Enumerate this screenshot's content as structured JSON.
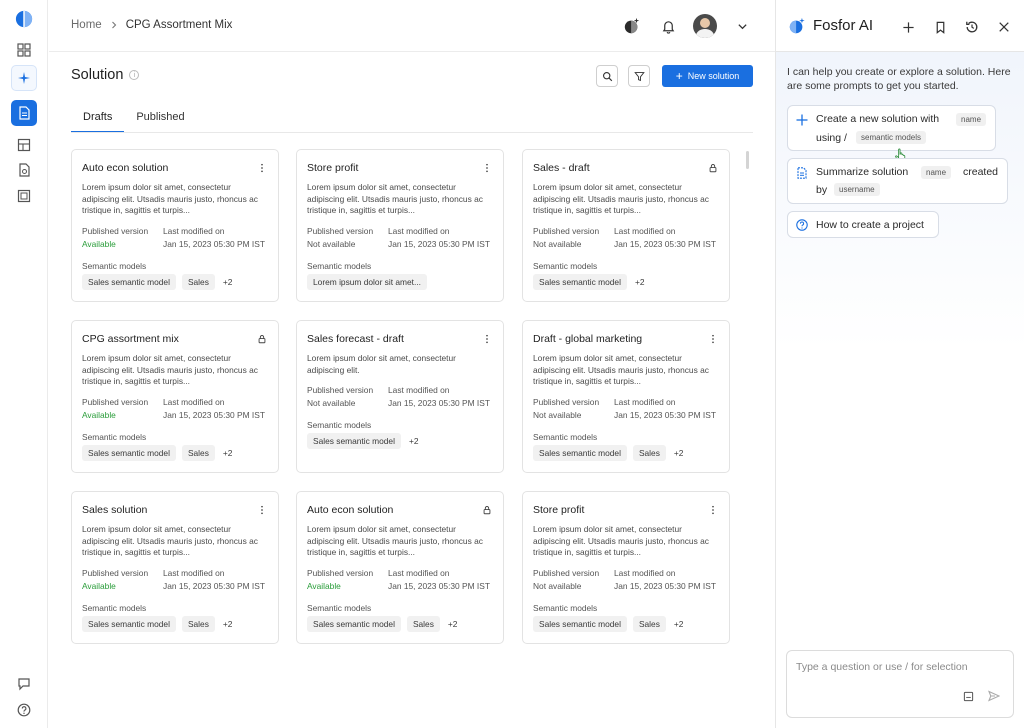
{
  "breadcrumb": {
    "home": "Home",
    "current": "CPG Assortment Mix"
  },
  "page": {
    "title": "Solution",
    "new_button": "New solution"
  },
  "tabs": [
    "Drafts",
    "Published"
  ],
  "cards": [
    {
      "title": "Auto econ solution",
      "locked": false,
      "description": "Lorem ipsum dolor sit amet, consectetur adipiscing elit. Utsadis mauris justo, rhoncus ac tristique in, sagittis et turpis...",
      "published_label": "Published version",
      "published_value": "Available",
      "published_available": true,
      "modified_label": "Last modified on",
      "modified_value": "Jan 15, 2023 05:30 PM IST",
      "models_label": "Semantic models",
      "chips": [
        "Sales semantic model",
        "Sales"
      ],
      "more": "+2"
    },
    {
      "title": "Store profit",
      "locked": false,
      "description": "Lorem ipsum dolor sit amet, consectetur adipiscing elit. Utsadis mauris justo, rhoncus ac tristique in, sagittis et turpis...",
      "published_label": "Published version",
      "published_value": "Not available",
      "published_available": false,
      "modified_label": "Last modified on",
      "modified_value": "Jan 15, 2023 05:30 PM IST",
      "models_label": "Semantic models",
      "chips": [
        "Lorem ipsum dolor sit amet..."
      ],
      "more": ""
    },
    {
      "title": "Sales - draft",
      "locked": true,
      "description": "Lorem ipsum dolor sit amet, consectetur adipiscing elit. Utsadis mauris justo, rhoncus ac tristique in, sagittis et turpis...",
      "published_label": "Published version",
      "published_value": "Not available",
      "published_available": false,
      "modified_label": "Last modified on",
      "modified_value": "Jan 15, 2023 05:30 PM IST",
      "models_label": "Semantic models",
      "chips": [
        "Sales semantic model"
      ],
      "more": "+2"
    },
    {
      "title": "CPG assortment mix",
      "locked": true,
      "description": "Lorem ipsum dolor sit amet, consectetur adipiscing elit. Utsadis mauris justo, rhoncus ac tristique in, sagittis et turpis...",
      "published_label": "Published version",
      "published_value": "Available",
      "published_available": true,
      "modified_label": "Last modified on",
      "modified_value": "Jan 15, 2023 05:30 PM IST",
      "models_label": "Semantic models",
      "chips": [
        "Sales semantic model",
        "Sales"
      ],
      "more": "+2"
    },
    {
      "title": "Sales forecast - draft",
      "locked": false,
      "description": "Lorem ipsum dolor sit amet, consectetur adipiscing elit.",
      "published_label": "Published version",
      "published_value": "Not available",
      "published_available": false,
      "modified_label": "Last modified on",
      "modified_value": "Jan 15, 2023 05:30 PM IST",
      "models_label": "Semantic models",
      "chips": [
        "Sales semantic model"
      ],
      "more": "+2"
    },
    {
      "title": "Draft - global marketing",
      "locked": false,
      "description": "Lorem ipsum dolor sit amet, consectetur adipiscing elit. Utsadis mauris justo, rhoncus ac tristique in, sagittis et turpis...",
      "published_label": "Published version",
      "published_value": "Not available",
      "published_available": false,
      "modified_label": "Last modified on",
      "modified_value": "Jan 15, 2023 05:30 PM IST",
      "models_label": "Semantic models",
      "chips": [
        "Sales semantic model",
        "Sales"
      ],
      "more": "+2"
    },
    {
      "title": "Sales solution",
      "locked": false,
      "description": "Lorem ipsum dolor sit amet, consectetur adipiscing elit. Utsadis mauris justo, rhoncus ac tristique in, sagittis et turpis...",
      "published_label": "Published version",
      "published_value": "Available",
      "published_available": true,
      "modified_label": "Last modified on",
      "modified_value": "Jan 15, 2023 05:30 PM IST",
      "models_label": "Semantic models",
      "chips": [
        "Sales semantic model",
        "Sales"
      ],
      "more": "+2"
    },
    {
      "title": "Auto econ solution",
      "locked": true,
      "description": "Lorem ipsum dolor sit amet, consectetur adipiscing elit. Utsadis mauris justo, rhoncus ac tristique in, sagittis et turpis...",
      "published_label": "Published version",
      "published_value": "Available",
      "published_available": true,
      "modified_label": "Last modified on",
      "modified_value": "Jan 15, 2023 05:30 PM IST",
      "models_label": "Semantic models",
      "chips": [
        "Sales semantic model",
        "Sales"
      ],
      "more": "+2"
    },
    {
      "title": "Store profit",
      "locked": false,
      "description": "Lorem ipsum dolor sit amet, consectetur adipiscing elit. Utsadis mauris justo, rhoncus ac tristique in, sagittis et turpis...",
      "published_label": "Published version",
      "published_value": "Not available",
      "published_available": false,
      "modified_label": "Last modified on",
      "modified_value": "Jan 15, 2023 05:30 PM IST",
      "models_label": "Semantic models",
      "chips": [
        "Sales semantic model",
        "Sales"
      ],
      "more": "+2"
    }
  ],
  "ai": {
    "title": "Fosfor AI",
    "intro": "I can help you create or explore a solution. Here are some prompts to get you started.",
    "prompts": [
      {
        "icon": "plus-icon",
        "part1": "Create a new solution with",
        "tag1": "name",
        "part2": "using /",
        "tag2": "semantic models"
      },
      {
        "icon": "document-icon",
        "part1": "Summarize solution",
        "tag1": "name",
        "part2": "created",
        "part3": "by",
        "tag2": "username"
      },
      {
        "icon": "question-icon",
        "part1": "How to create a project"
      }
    ],
    "input_placeholder": "Type a question or use / for selection"
  },
  "colors": {
    "accent": "#1a6fe0",
    "available": "#2a9d3a"
  }
}
